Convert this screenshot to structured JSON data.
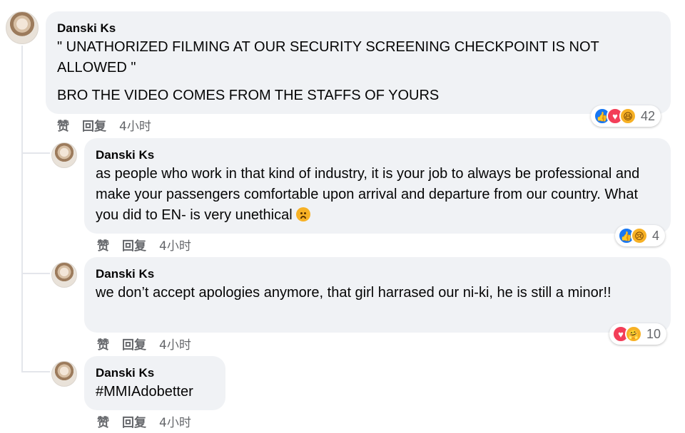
{
  "actions": {
    "like": "赞",
    "reply": "回复"
  },
  "comments": [
    {
      "author": "Danski Ks",
      "paragraph1": "\" UNATHORIZED FILMING AT OUR SECURITY SCREENING CHECKPOINT IS NOT ALLOWED \"",
      "paragraph2": "BRO THE VIDEO COMES FROM THE STAFFS OF YOURS",
      "time": "4小时",
      "reactions": {
        "icons": [
          "like-icon",
          "love-icon",
          "haha-icon"
        ],
        "count": "42"
      }
    },
    {
      "author": "Danski Ks",
      "text": "as people who work in that kind of industry, it is your job to always be professional and make your passengers comfortable upon arrival and departure from our country. What you did to EN- is very unethical",
      "time": "4小时",
      "reactions": {
        "icons": [
          "like-icon",
          "sad-icon"
        ],
        "count": "4"
      }
    },
    {
      "author": "Danski Ks",
      "text": "we don’t accept apologies anymore, that girl harrased our ni-ki, he is still a minor!!",
      "time": "4小时",
      "reactions": {
        "icons": [
          "love-icon",
          "care-icon"
        ],
        "count": "10"
      }
    },
    {
      "author": "Danski Ks",
      "text": "#MMIAdobetter",
      "time": "4小时"
    }
  ],
  "colors": {
    "bubble": "#f0f2f5",
    "meta": "#65676b",
    "like": "#1877f2",
    "love": "#f33e58",
    "emoji": "#f7b125"
  }
}
